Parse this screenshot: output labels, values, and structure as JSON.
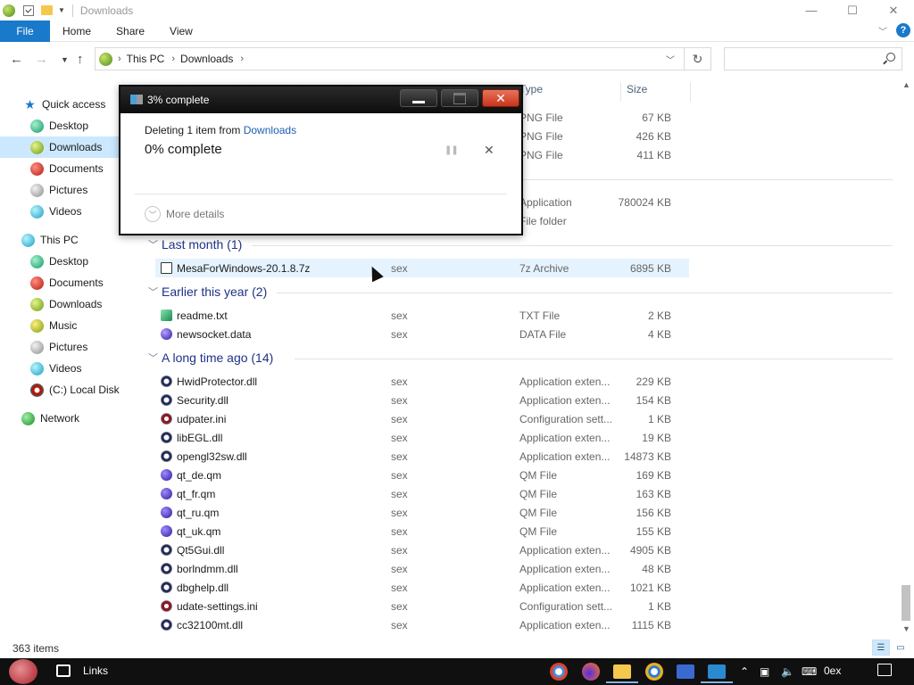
{
  "window": {
    "title": "Downloads"
  },
  "ribbon": {
    "tabs": [
      "File",
      "Home",
      "Share",
      "View"
    ]
  },
  "address": {
    "crumbs": [
      "This PC",
      "Downloads"
    ]
  },
  "search": {
    "placeholder": ""
  },
  "nav": {
    "items": [
      {
        "label": "Quick access",
        "icon": "star-icon"
      },
      {
        "label": "Desktop",
        "icon": "desktop-icon"
      },
      {
        "label": "Downloads",
        "icon": "downloads-icon",
        "selected": true
      },
      {
        "label": "Documents",
        "icon": "documents-icon"
      },
      {
        "label": "Pictures",
        "icon": "pictures-icon"
      },
      {
        "label": "Videos",
        "icon": "videos-icon"
      },
      {
        "label": "This PC",
        "icon": "this-pc-icon"
      },
      {
        "label": "Desktop",
        "icon": "desktop-icon"
      },
      {
        "label": "Documents",
        "icon": "documents-icon"
      },
      {
        "label": "Downloads",
        "icon": "downloads-icon"
      },
      {
        "label": "Music",
        "icon": "music-icon"
      },
      {
        "label": "Pictures",
        "icon": "pictures-icon"
      },
      {
        "label": "Videos",
        "icon": "videos-icon"
      },
      {
        "label": "(C:) Local Disk",
        "icon": "disk-icon"
      },
      {
        "label": "Network",
        "icon": "network-icon"
      }
    ]
  },
  "columns": {
    "type": "Type",
    "size": "Size"
  },
  "partial_rows": [
    {
      "type": "PNG File",
      "size": "67 KB"
    },
    {
      "type": "PNG File",
      "size": "426 KB"
    },
    {
      "type": "PNG File",
      "size": "411 KB"
    },
    {
      "type": "Application",
      "size": "780024 KB"
    },
    {
      "type": "File folder",
      "size": ""
    }
  ],
  "groups": [
    {
      "title": "Last month (1)",
      "files": [
        {
          "name": "MesaForWindows-20.1.8.7z",
          "date": "sex",
          "type": "7z Archive",
          "size": "6895 KB",
          "kind": "7z"
        }
      ]
    },
    {
      "title": "Earlier this year (2)",
      "files": [
        {
          "name": "readme.txt",
          "date": "sex",
          "type": "TXT File",
          "size": "2 KB",
          "kind": "txt"
        },
        {
          "name": "newsocket.data",
          "date": "sex",
          "type": "DATA File",
          "size": "4 KB",
          "kind": "data"
        }
      ]
    },
    {
      "title": "A long time ago (14)",
      "files": [
        {
          "name": "HwidProtector.dll",
          "date": "sex",
          "type": "Application exten...",
          "size": "229 KB",
          "kind": "dll"
        },
        {
          "name": "Security.dll",
          "date": "sex",
          "type": "Application exten...",
          "size": "154 KB",
          "kind": "dll"
        },
        {
          "name": "udpater.ini",
          "date": "sex",
          "type": "Configuration sett...",
          "size": "1 KB",
          "kind": "ini"
        },
        {
          "name": "libEGL.dll",
          "date": "sex",
          "type": "Application exten...",
          "size": "19 KB",
          "kind": "dll"
        },
        {
          "name": "opengl32sw.dll",
          "date": "sex",
          "type": "Application exten...",
          "size": "14873 KB",
          "kind": "dll"
        },
        {
          "name": "qt_de.qm",
          "date": "sex",
          "type": "QM File",
          "size": "169 KB",
          "kind": "qm"
        },
        {
          "name": "qt_fr.qm",
          "date": "sex",
          "type": "QM File",
          "size": "163 KB",
          "kind": "qm"
        },
        {
          "name": "qt_ru.qm",
          "date": "sex",
          "type": "QM File",
          "size": "156 KB",
          "kind": "qm"
        },
        {
          "name": "qt_uk.qm",
          "date": "sex",
          "type": "QM File",
          "size": "155 KB",
          "kind": "qm"
        },
        {
          "name": "Qt5Gui.dll",
          "date": "sex",
          "type": "Application exten...",
          "size": "4905 KB",
          "kind": "dll"
        },
        {
          "name": "borlndmm.dll",
          "date": "sex",
          "type": "Application exten...",
          "size": "48 KB",
          "kind": "dll"
        },
        {
          "name": "dbghelp.dll",
          "date": "sex",
          "type": "Application exten...",
          "size": "1021 KB",
          "kind": "dll"
        },
        {
          "name": "udate-settings.ini",
          "date": "sex",
          "type": "Configuration sett...",
          "size": "1 KB",
          "kind": "ini"
        },
        {
          "name": "cc32100mt.dll",
          "date": "sex",
          "type": "Application exten...",
          "size": "1115 KB",
          "kind": "dll"
        }
      ]
    }
  ],
  "status": {
    "count": "363 items"
  },
  "taskbar": {
    "links": "Links",
    "clock": "0ex"
  },
  "dialog": {
    "title": "3% complete",
    "desc_prefix": "Deleting 1 item from ",
    "desc_link": "Downloads",
    "percent": "0% complete",
    "more": "More details",
    "progress_fraction": 0.0
  },
  "colors": {
    "accent": "#1979ca",
    "selected": "#cce8ff",
    "group": "#1e3287"
  }
}
